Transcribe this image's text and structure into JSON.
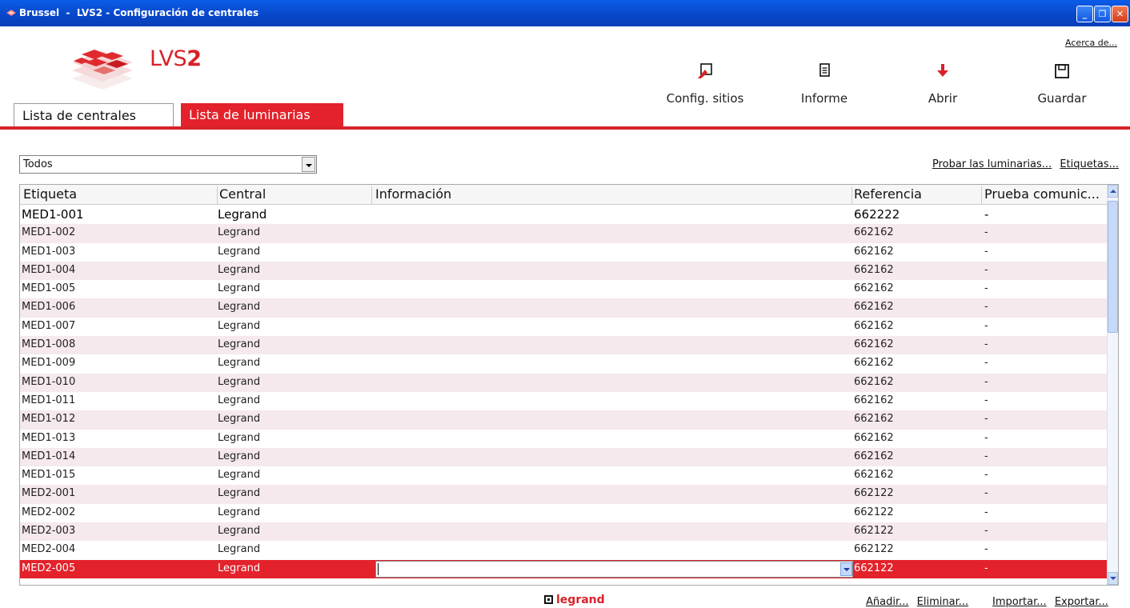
{
  "window": {
    "title": "Brussel  -  LVS2 - Configuración de centrales",
    "minimize": "_",
    "restore": "❐",
    "close": "✕"
  },
  "header": {
    "about_link": "Acerca de...",
    "brand_prefix": "LVS",
    "brand_suffix": "2",
    "tabs": [
      {
        "label": "Lista de centrales",
        "active": false
      },
      {
        "label": "Lista de luminarias",
        "active": true
      }
    ],
    "toolbar": [
      {
        "label": "Config. sitios",
        "icon": "config-sites-icon"
      },
      {
        "label": "Informe",
        "icon": "report-icon"
      },
      {
        "label": "Abrir",
        "icon": "open-icon"
      },
      {
        "label": "Guardar",
        "icon": "save-icon"
      }
    ],
    "accent_color": "#d8222a"
  },
  "filter": {
    "selected": "Todos",
    "links": [
      "Probar las luminarias...",
      "Etiquetas..."
    ]
  },
  "table": {
    "columns": [
      "Etiqueta",
      "Central",
      "Información",
      "Referencia",
      "Prueba comunic..."
    ],
    "rows": [
      [
        "MED1-001",
        "Legrand",
        "",
        "662222",
        "-"
      ],
      [
        "MED1-002",
        "Legrand",
        "",
        "662162",
        "-"
      ],
      [
        "MED1-003",
        "Legrand",
        "",
        "662162",
        "-"
      ],
      [
        "MED1-004",
        "Legrand",
        "",
        "662162",
        "-"
      ],
      [
        "MED1-005",
        "Legrand",
        "",
        "662162",
        "-"
      ],
      [
        "MED1-006",
        "Legrand",
        "",
        "662162",
        "-"
      ],
      [
        "MED1-007",
        "Legrand",
        "",
        "662162",
        "-"
      ],
      [
        "MED1-008",
        "Legrand",
        "",
        "662162",
        "-"
      ],
      [
        "MED1-009",
        "Legrand",
        "",
        "662162",
        "-"
      ],
      [
        "MED1-010",
        "Legrand",
        "",
        "662162",
        "-"
      ],
      [
        "MED1-011",
        "Legrand",
        "",
        "662162",
        "-"
      ],
      [
        "MED1-012",
        "Legrand",
        "",
        "662162",
        "-"
      ],
      [
        "MED1-013",
        "Legrand",
        "",
        "662162",
        "-"
      ],
      [
        "MED1-014",
        "Legrand",
        "",
        "662162",
        "-"
      ],
      [
        "MED1-015",
        "Legrand",
        "",
        "662162",
        "-"
      ],
      [
        "MED2-001",
        "Legrand",
        "",
        "662122",
        "-"
      ],
      [
        "MED2-002",
        "Legrand",
        "",
        "662122",
        "-"
      ],
      [
        "MED2-003",
        "Legrand",
        "",
        "662122",
        "-"
      ],
      [
        "MED2-004",
        "Legrand",
        "",
        "662122",
        "-"
      ],
      [
        "MED2-005",
        "Legrand",
        "",
        "662122",
        "-"
      ]
    ],
    "selected_row": 19
  },
  "footer": {
    "brand": "legrand",
    "links": [
      "Añadir...",
      "Eliminar...",
      "Importar...",
      "Exportar..."
    ]
  }
}
